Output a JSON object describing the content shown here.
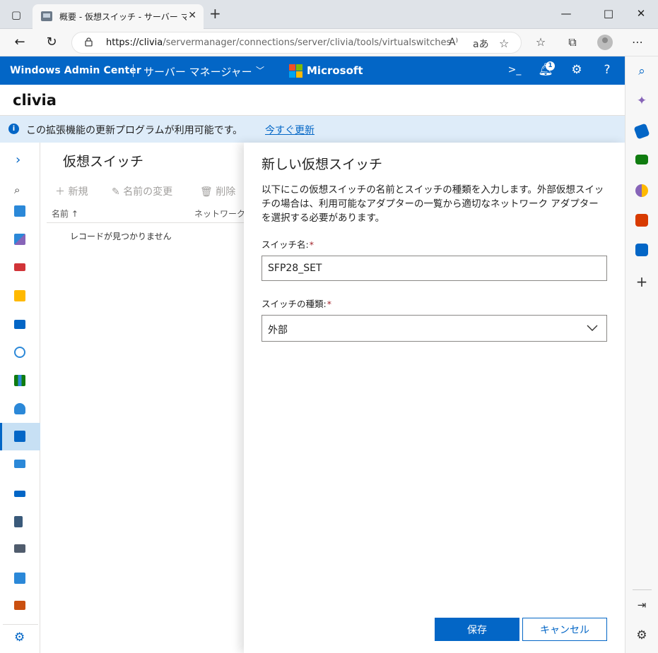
{
  "browser": {
    "tab_title": "概要 - 仮想スイッチ - サーバー マネージャー",
    "url_host": "https://clivia",
    "url_path": "/servermanager/connections/server/clivia/tools/virtualswitches",
    "read_aloud_label": "A⁾",
    "translate_label": "aあ"
  },
  "wac": {
    "title": "Windows Admin Center",
    "tool_selector": "サーバー マネージャー",
    "brand": "Microsoft",
    "notification_count": "1",
    "server_name": "clivia"
  },
  "notice": {
    "text": "この拡張機能の更新プログラムが利用可能です。",
    "link": "今すぐ更新"
  },
  "list": {
    "title": "仮想スイッチ",
    "cmd_new": "新規",
    "cmd_rename": "名前の変更",
    "cmd_delete": "削除",
    "col_name": "名前 ↑",
    "col_network": "ネットワーク",
    "empty": "レコードが見つかりません"
  },
  "panel": {
    "title": "新しい仮想スイッチ",
    "description": "以下にこの仮想スイッチの名前とスイッチの種類を入力します。外部仮想スイッチの場合は、利用可能なアダプターの一覧から適切なネットワーク アダプターを選択する必要があります。",
    "switch_name_label": "スイッチ名:",
    "switch_name_value": "SFP28_SET",
    "switch_type_label": "スイッチの種類:",
    "switch_type_value": "外部",
    "required_mark": "*",
    "save": "保存",
    "cancel": "キャンセル"
  },
  "colors": {
    "accent": "#0366c6",
    "notice_bg": "#deecf9",
    "required": "#a4262c"
  },
  "rail_icons": [
    "expand-icon",
    "search-icon",
    "overview-icon",
    "performance-icon",
    "firewall-icon",
    "files-icon",
    "storage-icon",
    "updates-icon",
    "apps-icon",
    "users-icon",
    "virtual-switches-icon",
    "remote-desktop-icon",
    "storage-replica-icon",
    "network-icon",
    "roles-icon",
    "scheduled-tasks-icon",
    "certificates-icon",
    "settings-icon"
  ]
}
